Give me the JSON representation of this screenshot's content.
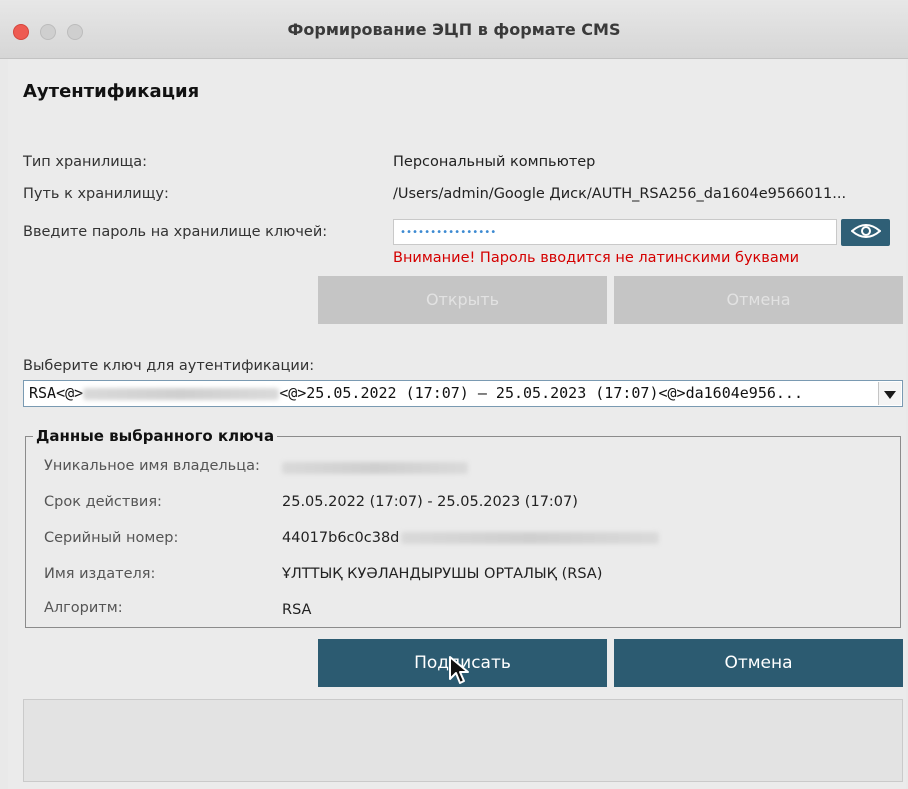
{
  "window": {
    "title": "Формирование ЭЦП в формате CMS"
  },
  "auth": {
    "section_title": "Аутентификация",
    "storage_type_label": "Тип хранилища:",
    "storage_type_value": "Персональный компьютер",
    "storage_path_label": "Путь к хранилищу:",
    "storage_path_value": "/Users/admin/Google Диск/AUTH_RSA256_da1604e9566011...",
    "password_label": "Введите пароль на хранилище ключей:",
    "password_value": "••••••••••••••••",
    "password_warning": "Внимание! Пароль вводится не латинскими буквами",
    "open_button": "Открыть",
    "cancel_button_top": "Отмена"
  },
  "key_select": {
    "label": "Выберите ключ для аутентификации:",
    "prefix": "RSA<@>",
    "suffix": "<@>25.05.2022 (17:07) – 25.05.2023 (17:07)<@>da1604e956..."
  },
  "key_details": {
    "group_title": "Данные выбранного ключа",
    "owner_label": "Уникальное имя владельца:",
    "validity_label": "Срок действия:",
    "validity_value": "25.05.2022 (17:07) - 25.05.2023 (17:07)",
    "serial_label": "Серийный номер:",
    "serial_value_visible": "44017b6c0c38d",
    "issuer_label": "Имя издателя:",
    "issuer_value": "ҰЛТТЫҚ КУӘЛАНДЫРУШЫ ОРТАЛЫҚ (RSA)",
    "algorithm_label": "Алгоритм:",
    "algorithm_value": "RSA"
  },
  "actions": {
    "sign_button": "Подписать",
    "cancel_button": "Отмена"
  },
  "colors": {
    "primary_button": "#2c5b71",
    "warning_text": "#d40000",
    "close_light": "#ee5b52"
  },
  "icons": {
    "show_password": "eye-icon",
    "dropdown": "triangle-down-icon",
    "cursor": "mouse-pointer-icon"
  }
}
